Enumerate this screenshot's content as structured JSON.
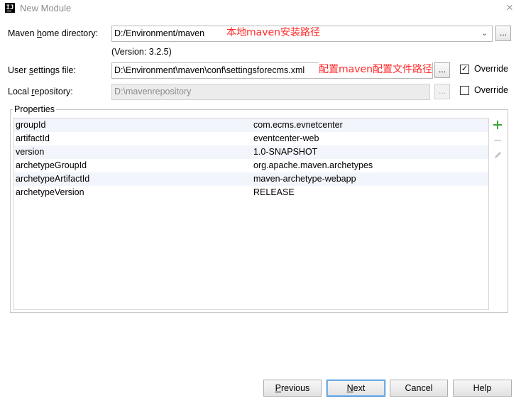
{
  "window": {
    "title": "New Module",
    "close_glyph": "×"
  },
  "form": {
    "maven_home": {
      "label_pre": "Maven ",
      "label_mnemonic": "h",
      "label_post": "ome directory:",
      "value": "D:/Environment/maven",
      "annotation": "本地maven安装路径",
      "browse": "..."
    },
    "version_note": "(Version: 3.2.5)",
    "user_settings": {
      "label_pre": "User ",
      "label_mnemonic": "s",
      "label_post": "ettings file:",
      "value": "D:\\Environment\\maven\\conf\\settingsforecms.xml",
      "annotation": "配置maven配置文件路径",
      "browse": "...",
      "override_label": "Override",
      "override_checked": true
    },
    "local_repo": {
      "label_pre": "Local ",
      "label_mnemonic": "r",
      "label_post": "epository:",
      "value": "D:\\mavenrepository",
      "browse": "...",
      "override_label": "Override",
      "override_checked": false
    }
  },
  "properties": {
    "title": "Properties",
    "rows": [
      {
        "key": "groupId",
        "value": "com.ecms.evnetcenter"
      },
      {
        "key": "artifactId",
        "value": "eventcenter-web"
      },
      {
        "key": "version",
        "value": "1.0-SNAPSHOT"
      },
      {
        "key": "archetypeGroupId",
        "value": "org.apache.maven.archetypes"
      },
      {
        "key": "archetypeArtifactId",
        "value": "maven-archetype-webapp"
      },
      {
        "key": "archetypeVersion",
        "value": "RELEASE"
      }
    ],
    "icons": [
      "add-icon",
      "remove-icon",
      "edit-icon"
    ]
  },
  "buttons": {
    "previous": {
      "mnemonic": "P",
      "rest": "revious"
    },
    "next": {
      "mnemonic": "N",
      "rest": "ext"
    },
    "cancel": "Cancel",
    "help": "Help"
  },
  "colors": {
    "annotation": "#ff2a2a",
    "add_icon": "#3aa63a",
    "default_button_border": "#2a7fd4"
  }
}
